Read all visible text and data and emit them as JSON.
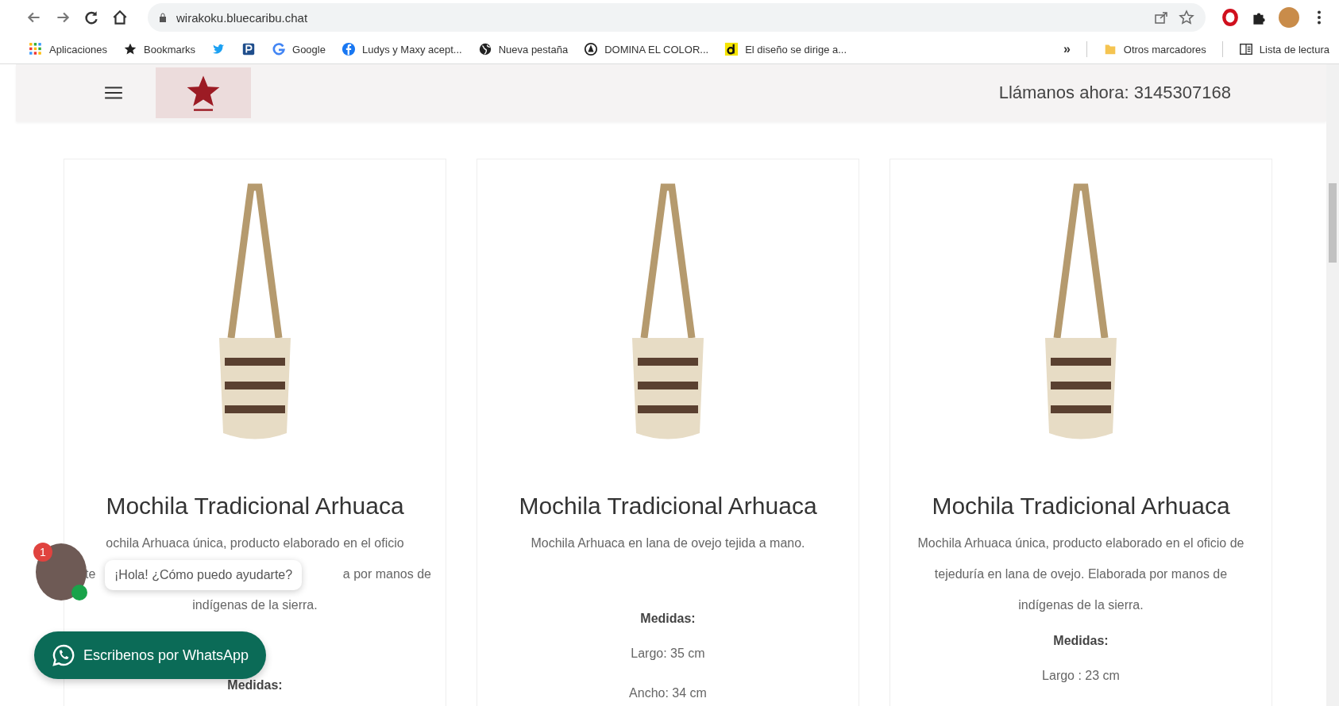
{
  "browser": {
    "url": "wirakoku.bluecaribu.chat",
    "bookmarks": [
      {
        "kind": "apps",
        "label": "Aplicaciones"
      },
      {
        "kind": "star",
        "label": "Bookmarks"
      },
      {
        "kind": "bird"
      },
      {
        "kind": "square"
      },
      {
        "kind": "letter",
        "label": "Google"
      },
      {
        "kind": "round",
        "label": "Ludys y Maxy acept..."
      },
      {
        "kind": "globe",
        "label": "Nueva pestaña"
      },
      {
        "kind": "ring",
        "label": "DOMINA EL COLOR..."
      },
      {
        "kind": "yellow",
        "label": "El diseño se dirige a..."
      }
    ],
    "overflow": "»",
    "other_bookmarks": "Otros marcadores",
    "reading_list": "Lista de lectura"
  },
  "header": {
    "phone": "Llámanos ahora: 3145307168"
  },
  "products": [
    {
      "title": "Mochila Tradicional Arhuaca",
      "description_parts": [
        "ochila Arhuaca única, producto elaborado en el oficio",
        "te",
        "a por manos de",
        "indígenas de la sierra."
      ],
      "measures_label": "Medidas:"
    },
    {
      "title": "Mochila Tradicional Arhuaca",
      "description": "Mochila Arhuaca en lana de ovejo tejida a mano.",
      "measures_label": "Medidas:",
      "measures": [
        "Largo: 35 cm",
        "Ancho: 34 cm"
      ]
    },
    {
      "title": "Mochila Tradicional Arhuaca",
      "description": "Mochila Arhuaca única, producto elaborado en el oficio de tejeduría en lana de ovejo. Elaborada por manos de indígenas de la sierra.",
      "measures_label": "Medidas:",
      "measures": [
        "Largo : 23 cm"
      ]
    }
  ],
  "chat": {
    "badge": "1",
    "greeting": "¡Hola! ¿Cómo puedo ayudarte?",
    "button": "Escribenos por WhatsApp"
  }
}
